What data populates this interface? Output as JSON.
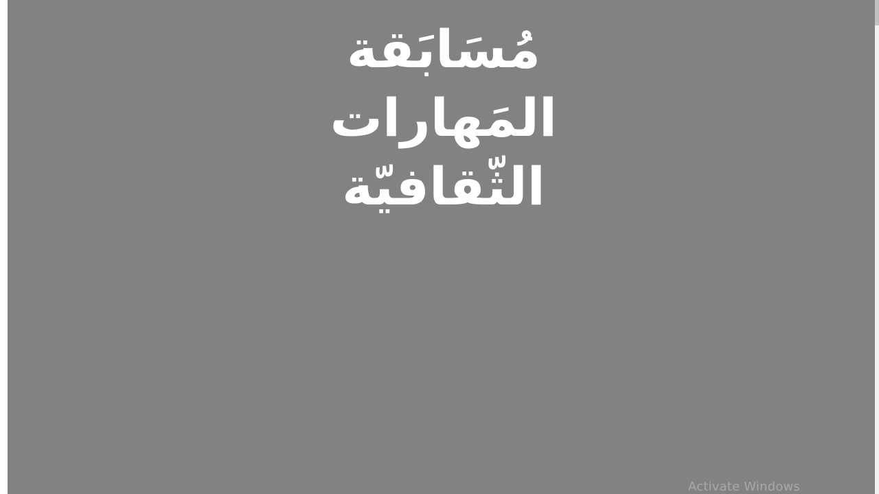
{
  "slide": {
    "background": "#828282",
    "title_color": "#ffffff",
    "title_lines": [
      "مُسَابَقة",
      "المَهارات",
      "الثّقافيّة"
    ]
  },
  "watermark": {
    "text": "Activate Windows",
    "color": "#a8a8a8"
  },
  "scrollbar": {
    "track_color": "#f1f1f1",
    "thumb_color": "#c1c1c1"
  }
}
